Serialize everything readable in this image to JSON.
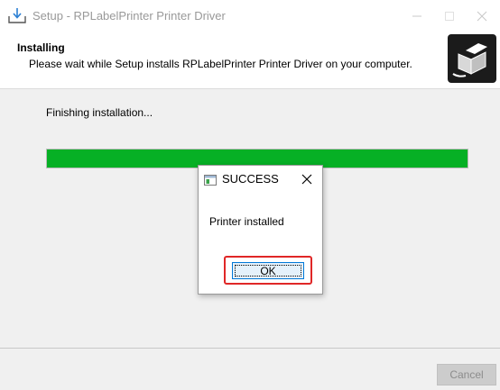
{
  "window": {
    "title": "Setup - RPLabelPrinter Printer Driver",
    "icon": "install-download-icon",
    "controls": [
      "minimize-icon",
      "maximize-icon",
      "close-icon"
    ]
  },
  "header": {
    "title": "Installing",
    "subtitle": "Please wait while Setup installs RPLabelPrinter Printer Driver on your computer.",
    "logo": "printer-box-icon"
  },
  "main": {
    "status_text": "Finishing installation...",
    "progress_fraction": 1.0
  },
  "footer": {
    "cancel_label": "Cancel"
  },
  "dialog": {
    "title": "SUCCESS",
    "message": "Printer installed",
    "ok_label": "OK",
    "icon": "app-window-icon"
  },
  "colors": {
    "progress": "#06b025",
    "highlight": "#e02727",
    "ok_border": "#0078d7"
  }
}
